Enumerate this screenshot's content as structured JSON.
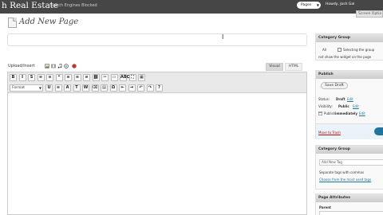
{
  "header": {
    "site_title": "h Real Estate",
    "site_tagline": "Search Engines Blocked",
    "page_select": "Pages",
    "howdy": "Howdy, Josh Gal",
    "screen_options": "Screen Optio"
  },
  "heading": {
    "title": "Add New Page"
  },
  "title_input": {
    "value": "",
    "placeholder": ""
  },
  "upload": {
    "label": "Upload/Insert"
  },
  "editor_tabs": {
    "visual": "Visual",
    "html": "HTML"
  },
  "toolbar": {
    "format": "Format",
    "row1_icons": [
      "bold-icon",
      "italic-icon",
      "strikethrough-icon",
      "bullet-list-icon",
      "numbered-list-icon",
      "blockquote-icon",
      "align-left-icon",
      "align-center-icon",
      "align-right-icon",
      "link-icon",
      "unlink-icon",
      "more-tag-icon",
      "spellcheck-icon",
      "fullscreen-icon",
      "kitchen-sink-icon"
    ],
    "row1_glyphs": [
      "B",
      "I",
      "S",
      "≡",
      "≡",
      "❝",
      "≡",
      "≡",
      "≡",
      "⛓",
      "✂",
      "▭",
      "ABC",
      "⛶",
      "▦"
    ],
    "row2_icons": [
      "underline-icon",
      "justify-icon",
      "text-color-icon",
      "paste-text-icon",
      "paste-word-icon",
      "remove-format-icon",
      "media-icon",
      "special-char-icon",
      "outdent-icon",
      "indent-icon",
      "undo-icon",
      "redo-icon",
      "help-icon"
    ],
    "row2_glyphs": [
      "U",
      "≡",
      "A",
      "T",
      "W",
      "⌫",
      "▤",
      "Ω",
      "⇤",
      "⇥",
      "↶",
      "↷",
      "?"
    ]
  },
  "sidebar": {
    "category_group": {
      "title": "Category Group",
      "all_label": "All",
      "hint_line1": "Selecting the group",
      "hint_line2": "not show the widget on the page"
    },
    "publish": {
      "title": "Publish",
      "save_draft": "Save Draft",
      "status_label": "Status:",
      "status_value": "Draft",
      "status_edit": "Edit",
      "visibility_label": "Visibility:",
      "visibility_value": "Public",
      "visibility_edit": "Edit",
      "publish_label": "Publish",
      "publish_value": "immediately",
      "publish_edit": "Edit",
      "move_to_trash": "Move to Trash"
    },
    "category_group2": {
      "title": "Category Group",
      "add_tag": "Add New Tag",
      "separate": "Separate tags with commas",
      "choose": "Choose from the most used tags"
    },
    "page_attributes": {
      "title": "Page Attributes",
      "parent": "Parent"
    }
  }
}
